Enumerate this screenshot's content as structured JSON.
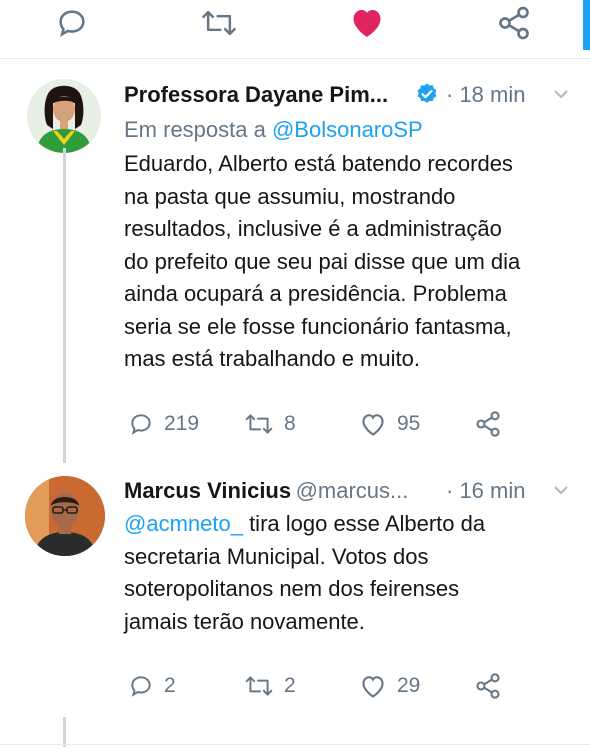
{
  "top_actions": {
    "reply": "reply-icon",
    "retweet": "retweet-icon",
    "like": "heart-icon",
    "share": "share-icon",
    "like_color": "#e0245e"
  },
  "tweets": [
    {
      "name": "Professora Dayane Pim...",
      "verified": true,
      "time": "· 18 min",
      "reply_prefix": "Em resposta a",
      "reply_handle": "@BolsonaroSP",
      "text_lines": [
        "Eduardo, Alberto está batendo recordes",
        "na pasta que assumiu, mostrando",
        "resultados, inclusive é a administração",
        "do prefeito que seu pai disse que um dia",
        "ainda ocupará a presidência. Problema",
        "seria se ele fosse funcionário fantasma,",
        "mas está trabalhando e muito."
      ],
      "replies": "219",
      "retweets": "8",
      "likes": "95"
    },
    {
      "name": "Marcus Vinicius",
      "handle": "@marcus...",
      "time": "· 16 min",
      "mention": "@acmneto_",
      "text_first_rest": " tira logo esse Alberto da",
      "text_lines": [
        "secretaria Municipal. Votos dos",
        "soteropolitanos nem dos feirenses",
        "jamais terão novamente."
      ],
      "replies": "2",
      "retweets": "2",
      "likes": "29"
    }
  ],
  "colors": {
    "accent": "#1da1f2",
    "muted": "#657786",
    "text": "#14171a"
  }
}
